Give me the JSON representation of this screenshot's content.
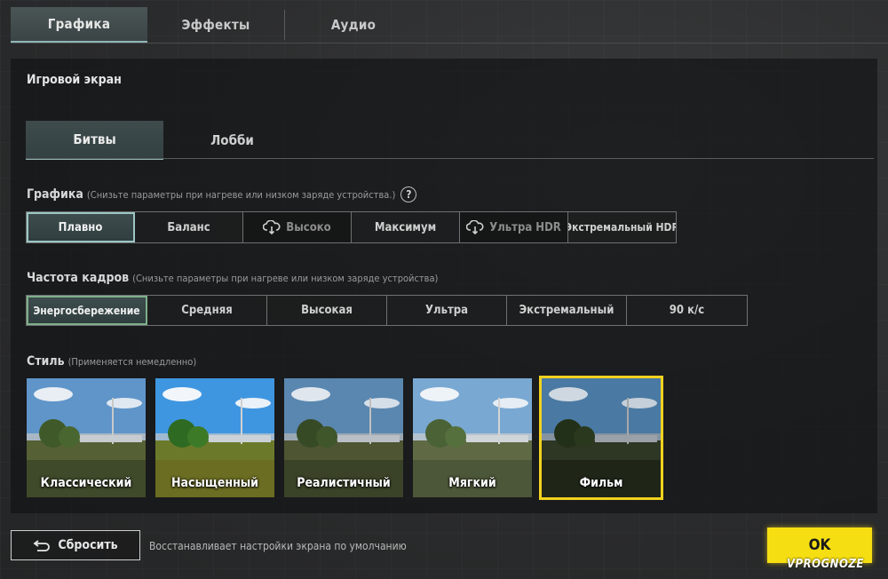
{
  "top_tabs": [
    {
      "label": "Графика",
      "active": true
    },
    {
      "label": "Эффекты",
      "active": false
    },
    {
      "label": "Аудио",
      "active": false
    }
  ],
  "section_title": "Игровой экран",
  "sub_tabs": [
    {
      "label": "Битвы",
      "active": true
    },
    {
      "label": "Лобби",
      "active": false
    }
  ],
  "graphics": {
    "label": "Графика",
    "hint": "(Снизьте параметры при нагреве или низком заряде устройства.)",
    "help_icon": "?",
    "options": [
      {
        "label": "Плавно",
        "state": "selected"
      },
      {
        "label": "Баланс",
        "state": "normal"
      },
      {
        "label": "Высоко",
        "state": "disabled",
        "icon": "cloud-download-icon"
      },
      {
        "label": "Максимум",
        "state": "normal"
      },
      {
        "label": "Ультра HDR",
        "state": "disabled",
        "icon": "cloud-download-icon"
      },
      {
        "label": "Экстремальный HDR",
        "state": "normal"
      }
    ]
  },
  "frame_rate": {
    "label": "Частота кадров",
    "hint": "(Снизьте параметры при нагреве или низком заряде устройства)",
    "options": [
      {
        "label": "Энергосбережение",
        "state": "selected"
      },
      {
        "label": "Средняя",
        "state": "normal"
      },
      {
        "label": "Высокая",
        "state": "normal"
      },
      {
        "label": "Ультра",
        "state": "normal"
      },
      {
        "label": "Экстремальный",
        "state": "normal"
      },
      {
        "label": "90 к/с",
        "state": "normal"
      }
    ]
  },
  "style": {
    "label": "Стиль",
    "hint": "(Применяется немедленно)",
    "cards": [
      {
        "label": "Классический",
        "selected": false
      },
      {
        "label": "Насыщенный",
        "selected": false
      },
      {
        "label": "Реалистичный",
        "selected": false
      },
      {
        "label": "Мягкий",
        "selected": false
      },
      {
        "label": "Фильм",
        "selected": true
      }
    ]
  },
  "reset": {
    "label": "Сбросить",
    "description": "Восстанавливает настройки экрана по умолчанию"
  },
  "ok_label": "OK",
  "watermark": "VPROGNOZE",
  "colors": {
    "accent_yellow": "#f5de12",
    "selected_outline": "#9cc6c4"
  }
}
